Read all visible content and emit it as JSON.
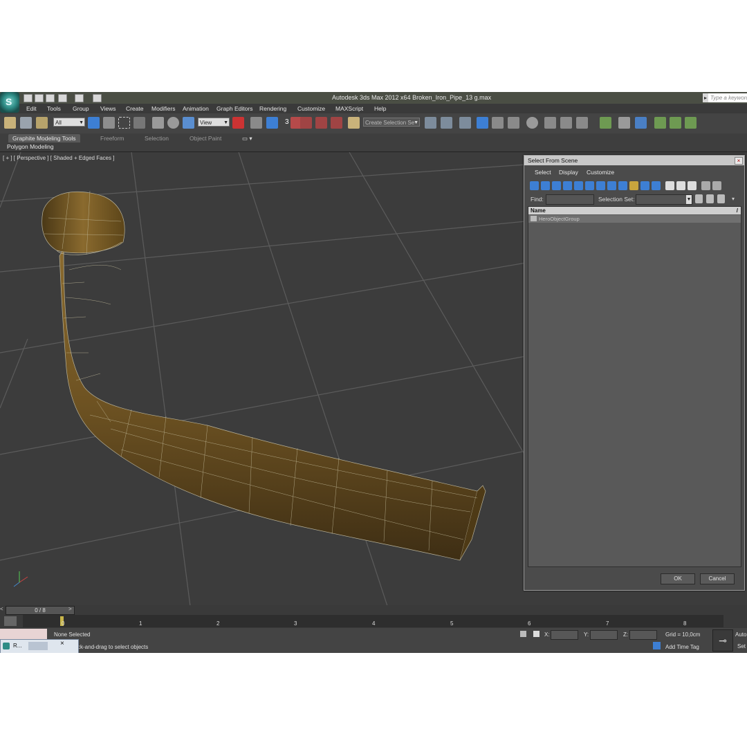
{
  "window": {
    "title": "Autodesk 3ds Max  2012 x64     Broken_Iron_Pipe_13 g.max",
    "search_placeholder": "Type a keyword"
  },
  "menu": [
    "Edit",
    "Tools",
    "Group",
    "Views",
    "Create",
    "Modifiers",
    "Animation",
    "Graph Editors",
    "Rendering",
    "Customize",
    "MAXScript",
    "Help"
  ],
  "toolbar": {
    "selection_filter": "All",
    "ref_coord": "View",
    "selection_set": "Create Selection Se",
    "spinner_label": "3"
  },
  "ribbon": {
    "tabs": [
      "Graphite Modeling Tools",
      "Freeform",
      "Selection",
      "Object Paint"
    ],
    "sub_label": "Polygon Modeling"
  },
  "viewport": {
    "label": "[ + ] [ Perspective ] [ Shaded + Edged Faces ]"
  },
  "dialog": {
    "title": "Select From Scene",
    "menu": [
      "Select",
      "Display",
      "Customize"
    ],
    "find_label": "Find:",
    "selection_set_label": "Selection Set:",
    "column_name": "Name",
    "rows": [
      "HeroObjectGroup"
    ],
    "ok_label": "OK",
    "cancel_label": "Cancel"
  },
  "timeline": {
    "frame_counter": "0 / 8",
    "ticks": [
      "0",
      "1",
      "2",
      "3",
      "4",
      "5",
      "6",
      "7",
      "8"
    ]
  },
  "status": {
    "selection": "None Selected",
    "prompt": "ck-and-drag to select objects",
    "x_label": "X:",
    "y_label": "Y:",
    "z_label": "Z:",
    "grid": "Grid = 10,0cm",
    "time_tag": "Add Time Tag",
    "auto_label": "Auto",
    "set_label": "Set",
    "taskbar_label": "R..."
  },
  "colors": {
    "accent_blue": "#3d7fd4",
    "pipe_brown": "#7a5a24",
    "viewport_bg": "#3c3c3c"
  }
}
